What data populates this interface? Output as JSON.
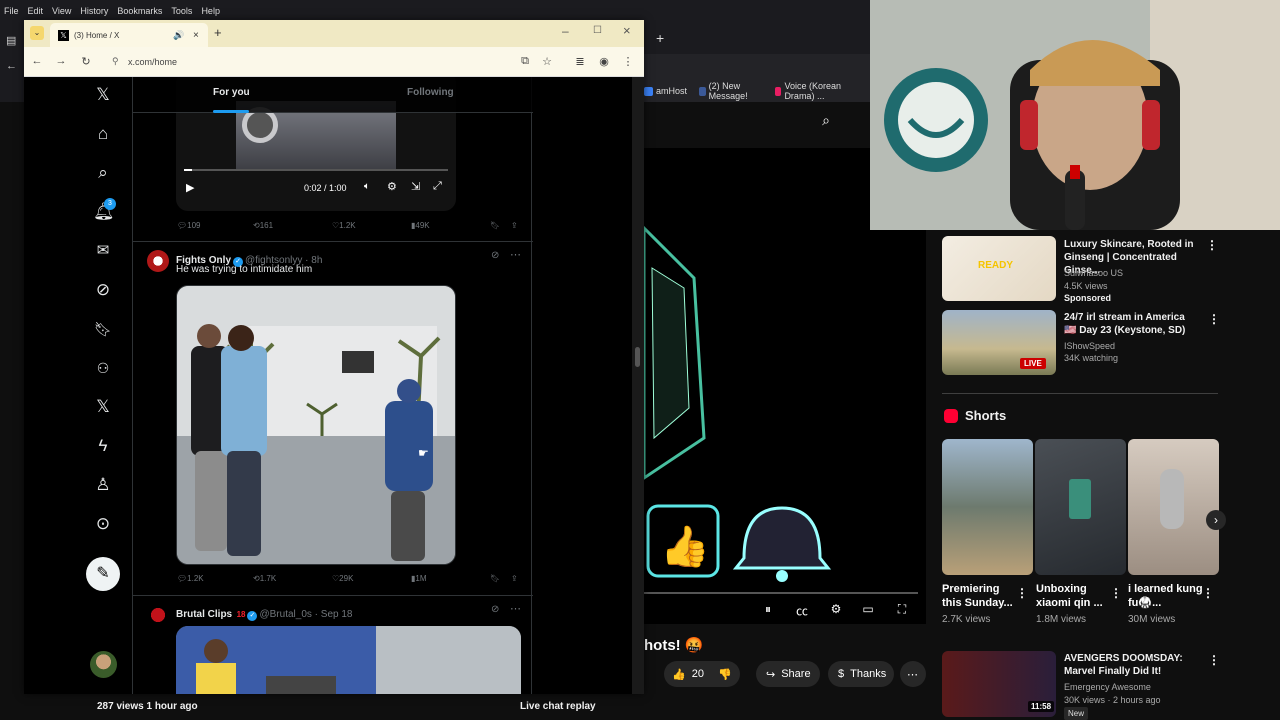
{
  "menubar": {
    "items": [
      "File",
      "Edit",
      "View",
      "History",
      "Bookmarks",
      "Tools",
      "Help"
    ]
  },
  "bookmarks": [
    {
      "label": "amHost",
      "color": "#3b82f6"
    },
    {
      "label": "(2) New Message!",
      "color": "#3b5998"
    },
    {
      "label": "Voice (Korean Drama) ...",
      "color": "#e91e63"
    }
  ],
  "x_window": {
    "tab_title": "(3) Home / X",
    "url": "x.com/home",
    "new_tab": "+",
    "feed_tabs": {
      "for_you": "For you",
      "following": "Following"
    },
    "video_time": "0:02 / 1:00",
    "tweet1_actions": {
      "replies": "109",
      "reposts": "161",
      "likes": "1.2K",
      "views": "49K"
    },
    "tweet2": {
      "name": "Fights Only",
      "handle": "@fightsonlyy · 8h",
      "text": "He was trying to intimidate him",
      "actions": {
        "replies": "1.2K",
        "reposts": "1.7K",
        "likes": "29K",
        "views": "1M"
      }
    },
    "tweet3": {
      "name": "Brutal Clips",
      "badge": "18",
      "handle": "@Brutal_0s · Sep 18"
    },
    "notification_count": "3"
  },
  "youtube": {
    "video_title": "hots! 🤬",
    "views_line": "287 views  1 hour ago",
    "live_chat": "Live chat replay",
    "like_count": "20",
    "share_label": "Share",
    "thanks_label": "Thanks",
    "recommendations": [
      {
        "title": "Luxury Skincare, Rooted in Ginseng | Concentrated Ginse...",
        "meta1": "Sulwhasoo US",
        "meta2": "4.5K views",
        "meta3": "Sponsored"
      },
      {
        "title": "24/7 irl stream in America 🇺🇸 Day 23 (Keystone, SD)",
        "meta1": "IShowSpeed",
        "meta2": "34K watching",
        "badge": "LIVE"
      }
    ],
    "shorts_header": "Shorts",
    "shorts": [
      {
        "title": "Premiering this Sunday...",
        "views": "2.7K views"
      },
      {
        "title": "Unboxing xiaomi qin ...",
        "views": "1.8M views"
      },
      {
        "title": "i learned kung fu🥋...",
        "views": "30M views"
      }
    ],
    "next_video": {
      "title": "AVENGERS DOOMSDAY: Marvel Finally Did It!",
      "channel": "Emergency Awesome",
      "meta": "30K views · 2 hours ago",
      "badge": "New",
      "duration": "11:58"
    }
  },
  "colors": {
    "x_blue": "#1d9bf0",
    "yt_red": "#ff0033",
    "firefox_bar": "#f0e9c4"
  }
}
